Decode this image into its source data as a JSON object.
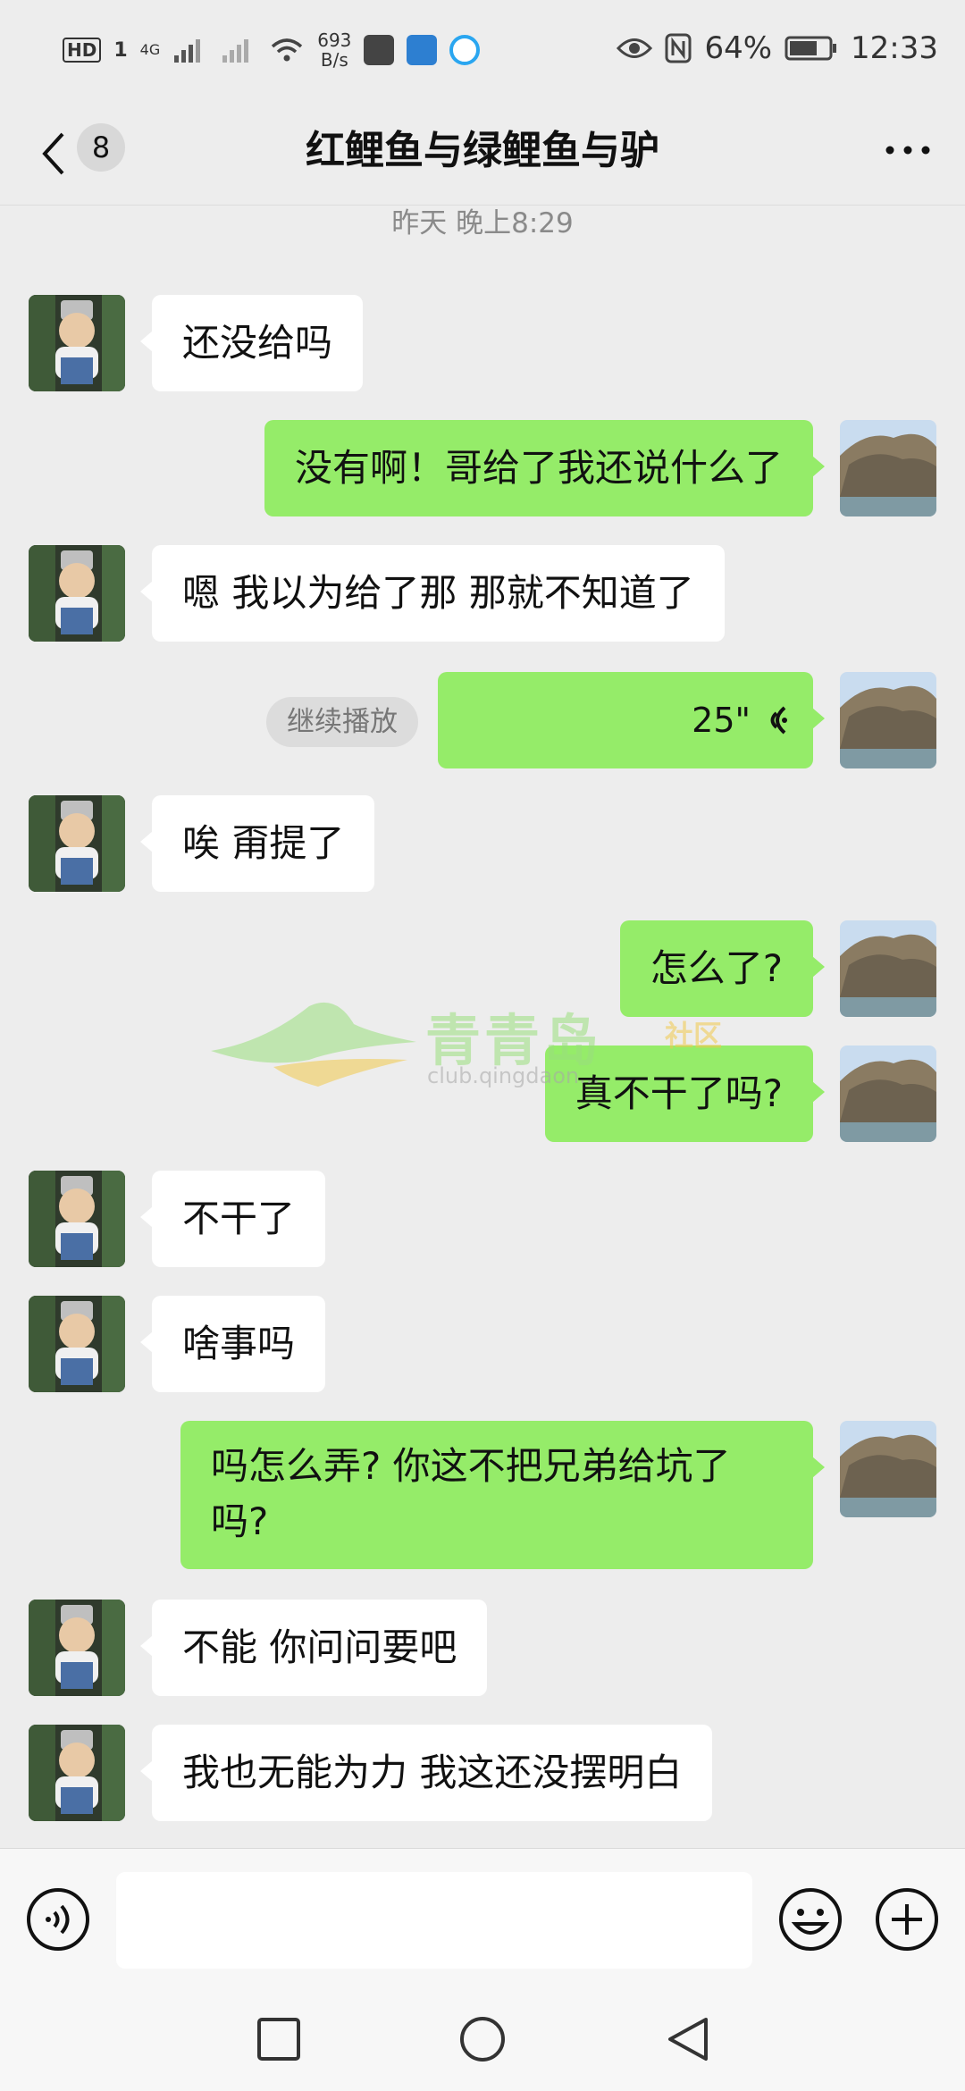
{
  "status_bar": {
    "hd": "HD",
    "sim": "1",
    "network": "4G",
    "speed_value": "693",
    "speed_unit": "B/s",
    "battery": "64%",
    "time": "12:33"
  },
  "header": {
    "unread_count": "8",
    "title": "红鲤鱼与绿鲤鱼与驴"
  },
  "timestamp": "昨天 晚上8:29",
  "messages": [
    {
      "side": "in",
      "text": "还没给吗"
    },
    {
      "side": "out",
      "text": "没有啊！哥给了我还说什么了"
    },
    {
      "side": "in",
      "text": "嗯 我以为给了那 那就不知道了"
    },
    {
      "side": "out",
      "type": "voice",
      "duration": "25\"",
      "action": "继续播放"
    },
    {
      "side": "in",
      "text": "唉 甭提了"
    },
    {
      "side": "out",
      "text": "怎么了?"
    },
    {
      "side": "out",
      "text": "真不干了吗?"
    },
    {
      "side": "in",
      "text": "不干了"
    },
    {
      "side": "in",
      "text": "啥事吗"
    },
    {
      "side": "out",
      "text": "吗怎么弄? 你这不把兄弟给坑了吗?"
    },
    {
      "side": "in",
      "text": "不能  你问问要吧"
    },
    {
      "side": "in",
      "text": "我也无能为力 我这还没摆明白"
    }
  ],
  "watermark": {
    "title": "青青岛",
    "tag": "社区",
    "url": "club.qingdaon..."
  },
  "colors": {
    "background": "#ededed",
    "outgoing_bubble": "#95ec69",
    "incoming_bubble": "#ffffff",
    "timestamp": "#8a8a8a"
  },
  "icons": {
    "back": "chevron-left-icon",
    "more": "more-horizontal-icon",
    "voice": "voice-wave-icon",
    "emoji": "smile-icon",
    "plus": "plus-circle-icon"
  }
}
